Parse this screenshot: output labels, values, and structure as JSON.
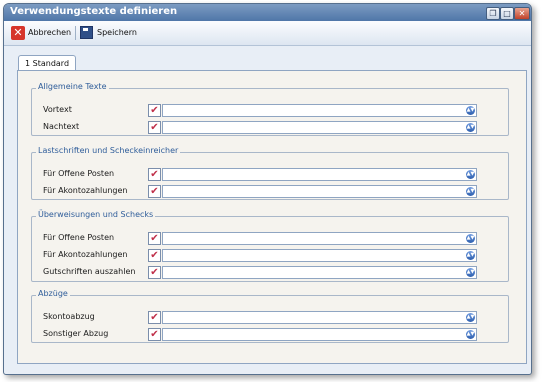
{
  "window": {
    "title": "Verwendungstexte definieren",
    "controls": {
      "restore": "❐",
      "maximize": "□",
      "close": "✕"
    }
  },
  "toolbar": {
    "cancel_label": "Abbrechen",
    "save_label": "Speichern"
  },
  "tabs": [
    {
      "label": "1 Standard"
    }
  ],
  "groups": [
    {
      "title": "Allgemeine Texte",
      "rows": [
        {
          "label": "Vortext",
          "value": ""
        },
        {
          "label": "Nachtext",
          "value": ""
        }
      ]
    },
    {
      "title": "Lastschriften und Scheckeinreicher",
      "rows": [
        {
          "label": "Für Offene Posten",
          "value": ""
        },
        {
          "label": "Für Akontozahlungen",
          "value": ""
        }
      ]
    },
    {
      "title": "Überweisungen und Schecks",
      "rows": [
        {
          "label": "Für Offene Posten",
          "value": ""
        },
        {
          "label": "Für Akontozahlungen",
          "value": ""
        },
        {
          "label": "Gutschriften auszahlen",
          "value": ""
        }
      ]
    },
    {
      "title": "Abzüge",
      "rows": [
        {
          "label": "Skontoabzug",
          "value": ""
        },
        {
          "label": "Sonstiger Abzug",
          "value": ""
        }
      ]
    }
  ],
  "icons": {
    "checkbox": "✔",
    "spin": "▲▼"
  },
  "colors": {
    "titlebar": "#4f76a8",
    "group_title": "#2f5d9a",
    "cancel_icon": "#d6342a"
  }
}
